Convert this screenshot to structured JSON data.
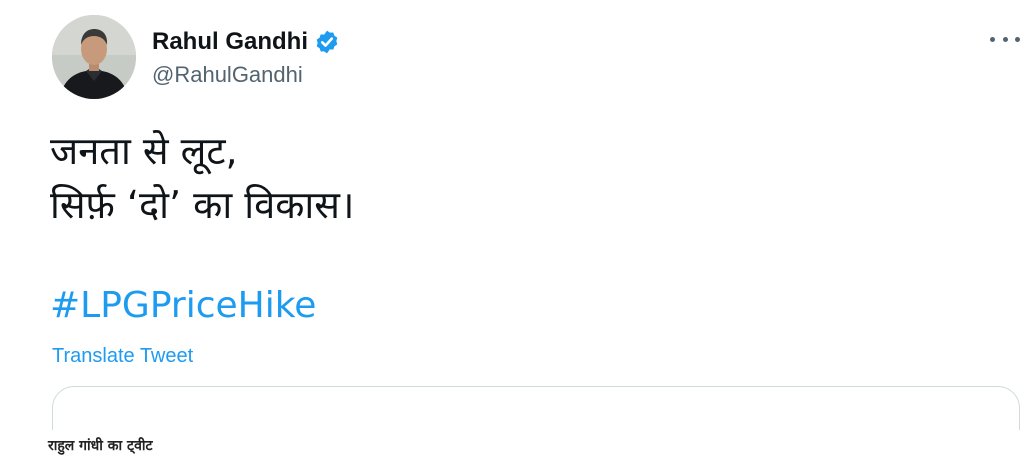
{
  "tweet": {
    "author_name": "Rahul Gandhi",
    "author_handle": "@RahulGandhi",
    "verified_icon": "verified-badge-icon",
    "more_icon": "more-options-icon",
    "text_lines": [
      "जनता से लूट,",
      "सिर्फ़ ‘दो’ का विकास।"
    ],
    "hashtag": "#LPGPriceHike",
    "translate_label": "Translate Tweet"
  },
  "caption": "राहुल गांधी का ट्वीट",
  "colors": {
    "link": "#1d9bf0",
    "verified": "#1d9bf0",
    "secondary_text": "#536471",
    "primary_text": "#0f1419"
  }
}
